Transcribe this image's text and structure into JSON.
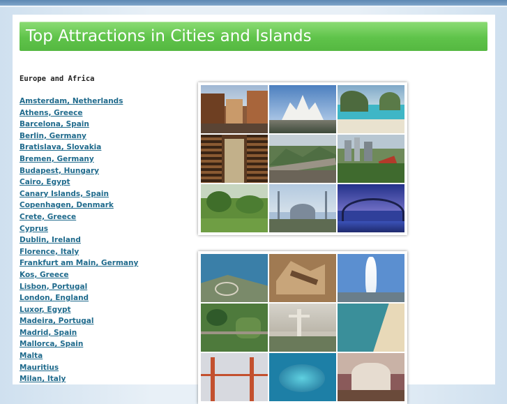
{
  "page": {
    "title": "Top Attractions in Cities and Islands"
  },
  "section": {
    "heading": "Europe and Africa"
  },
  "cities": [
    "Amsterdam, Netherlands",
    "Athens, Greece",
    "Barcelona, Spain",
    "Berlin, Germany",
    "Bratislava, Slovakia",
    "Bremen, Germany",
    "Budapest, Hungary",
    "Cairo, Egypt",
    "Canary Islands, Spain",
    "Copenhagen, Denmark",
    "Crete, Greece",
    "Cyprus",
    "Dublin, Ireland",
    "Florence, Italy",
    "Frankfurt am Main, Germany",
    "Kos, Greece",
    "Lisbon, Portugal",
    "London, England",
    "Luxor, Egypt",
    "Madeira, Portugal",
    "Madrid, Spain",
    "Mallorca, Spain",
    "Malta",
    "Mauritius",
    "Milan, Italy"
  ],
  "collages": [
    {
      "name": "collage-1",
      "tiles": [
        "street-scene-photo",
        "lotus-temple-photo",
        "tropical-beach-photo",
        "library-hall-photo",
        "great-wall-photo",
        "city-skyline-photo",
        "garden-park-photo",
        "blue-mosque-photo",
        "harbour-bridge-photo"
      ]
    },
    {
      "name": "collage-2",
      "tiles": [
        "coastal-aerial-photo",
        "desert-canyon-photo",
        "fountain-jet-photo",
        "park-aerial-photo",
        "christ-statue-photo",
        "beach-coast-photo",
        "golden-gate-photo",
        "lagoon-photo",
        "palace-photo"
      ]
    }
  ],
  "colors": {
    "banner_green": "#5fc34a",
    "link_blue": "#1f6a8c",
    "background_blue": "#cfe0ef"
  }
}
